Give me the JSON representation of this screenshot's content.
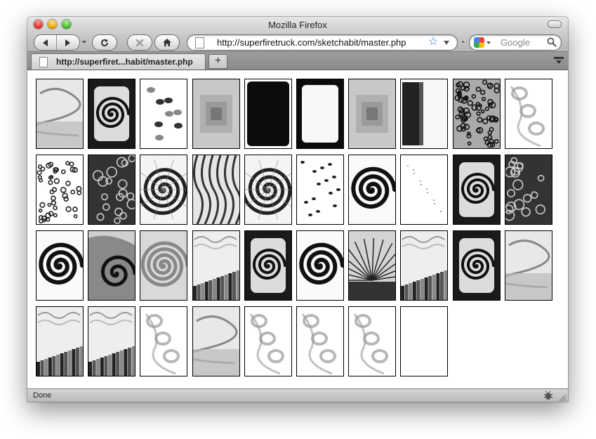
{
  "window": {
    "title": "Mozilla Firefox"
  },
  "toolbar": {
    "url": "http://superfiretruck.com/sketchabit/master.php",
    "search_placeholder": "Google"
  },
  "tabs": [
    {
      "label": "http://superfiret...habit/master.php"
    }
  ],
  "tab_new_label": "+",
  "status": {
    "text": "Done"
  },
  "gallery": {
    "columns": 10,
    "tiles": [
      {
        "style": "gray-scribble"
      },
      {
        "style": "dark-spiral"
      },
      {
        "style": "blobs-light"
      },
      {
        "style": "gray-squares"
      },
      {
        "style": "black-fill"
      },
      {
        "style": "white-center"
      },
      {
        "style": "gray-squares"
      },
      {
        "style": "half-dark"
      },
      {
        "style": "dense-circles"
      },
      {
        "style": "light-curls"
      },
      {
        "style": "circles-sparse"
      },
      {
        "style": "dark-circles"
      },
      {
        "style": "spiral-lines"
      },
      {
        "style": "wavy-lines"
      },
      {
        "style": "spiral-lines"
      },
      {
        "style": "dots"
      },
      {
        "style": "bold-spiral"
      },
      {
        "style": "tiny-dots"
      },
      {
        "style": "dark-spiral"
      },
      {
        "style": "dark-circles"
      },
      {
        "style": "bold-spiral"
      },
      {
        "style": "swirl-dark"
      },
      {
        "style": "gray-rings"
      },
      {
        "style": "city-gray"
      },
      {
        "style": "dark-spiral"
      },
      {
        "style": "bold-spiral"
      },
      {
        "style": "rays"
      },
      {
        "style": "city-gray"
      },
      {
        "style": "dark-spiral"
      },
      {
        "style": "gray-scribble"
      },
      {
        "style": "city-gray"
      },
      {
        "style": "city-gray"
      },
      {
        "style": "light-curls"
      },
      {
        "style": "gray-scribble"
      },
      {
        "style": "light-curls"
      },
      {
        "style": "light-curls"
      },
      {
        "style": "light-curls"
      },
      {
        "style": "empty"
      }
    ]
  }
}
